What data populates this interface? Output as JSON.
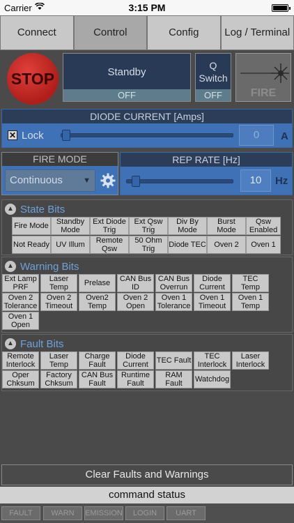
{
  "status_bar": {
    "carrier": "Carrier",
    "time": "3:15 PM"
  },
  "tabs": [
    {
      "label": "Connect"
    },
    {
      "label": "Control",
      "active": true
    },
    {
      "label": "Config"
    },
    {
      "label": "Log / Terminal"
    }
  ],
  "controls": {
    "stop_label": "STOP",
    "standby_label": "Standby",
    "standby_state": "OFF",
    "qswitch_label_1": "Q",
    "qswitch_label_2": "Switch",
    "qswitch_state": "OFF",
    "fire_label": "FIRE"
  },
  "diode_current": {
    "title": "DIODE CURRENT [Amps]",
    "lock_label": "Lock",
    "lock_checked": true,
    "value": "0",
    "unit": "A"
  },
  "fire_mode": {
    "title": "FIRE MODE",
    "selected": "Continuous"
  },
  "rep_rate": {
    "title": "REP RATE [Hz]",
    "value": "10",
    "unit": "Hz"
  },
  "state_bits": {
    "title": "State Bits",
    "rows": [
      [
        "Fire Mode",
        "Standby Mode",
        "Ext Diode Trig",
        "Ext Qsw Trig",
        "Div By Mode",
        "Burst Mode",
        "Qsw Enabled"
      ],
      [
        "Not Ready",
        "UV Illum",
        "Remote Qsw",
        "50 Ohm Trig",
        "Diode TEC",
        "Oven 2",
        "Oven 1"
      ]
    ]
  },
  "warning_bits": {
    "title": "Warning Bits",
    "rows": [
      [
        "Ext Lamp PRF",
        "Laser Temp",
        "Prelase",
        "CAN Bus ID",
        "CAN Bus Overrun",
        "Diode Current",
        "TEC Temp"
      ],
      [
        "Oven 2 Tolerance",
        "Oven 2 Timeout",
        "Oven2 Temp",
        "Oven 2 Open",
        "Oven 1 Tolerance",
        "Oven 1 Timeout",
        "Oven 1 Temp"
      ],
      [
        "Oven 1 Open"
      ]
    ]
  },
  "fault_bits": {
    "title": "Fault Bits",
    "rows": [
      [
        "Remote Interlock",
        "Laser Temp",
        "Charge Fault",
        "Diode Current",
        "TEC Fault",
        "TEC Interlock",
        "Laser Interlock"
      ],
      [
        "Oper Chksum",
        "Factory Chksum",
        "CAN Bus Fault",
        "Runtime Fault",
        "RAM Fault",
        "Watchdog"
      ]
    ]
  },
  "clear_button": "Clear Faults and Warnings",
  "command_status": "command status",
  "indicators": [
    "FAULT",
    "WARN",
    "EMISSION",
    "LOGIN",
    "UART"
  ],
  "colors": {
    "stop_red": "#c9231e",
    "panel_blue": "#3e71b5",
    "header_navy": "#2b3d57",
    "section_title_blue": "#6fa1d8"
  },
  "icons": {
    "laser": "laser-burst-icon",
    "gear": "gear-icon",
    "collapse": "chevron-up-circle-icon",
    "dropdown": "chevron-down-icon",
    "lock_check": "x-checkbox-icon",
    "wifi": "wifi-icon",
    "battery": "battery-icon"
  }
}
